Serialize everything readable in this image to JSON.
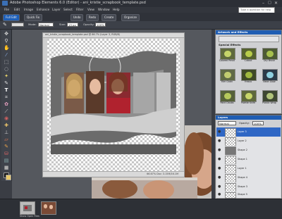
{
  "titlebar": {
    "title": "Adobe Photoshop Elements 6.0 (Editor) - ani_kristie_scrapbook_template.psd"
  },
  "menu": [
    "File",
    "Edit",
    "Image",
    "Enhance",
    "Layer",
    "Select",
    "Filter",
    "View",
    "Window",
    "Help"
  ],
  "help_search": {
    "placeholder": "Type a question for help"
  },
  "shortcuts": {
    "full_edit": "Full Edit",
    "quick_fix": "Quick Fix",
    "undo": "Undo",
    "redo": "Redo",
    "create": "Create",
    "organize": "Organize"
  },
  "options": {
    "mode": "Mode:",
    "mode_value": "Normal",
    "size": "Size:",
    "size_value": "13 px",
    "opacity": "Opacity:",
    "opacity_value": "100%"
  },
  "document": {
    "title": "ani_kristie_scrapbook_template.psd @ 66.7% (Layer 3, RGB/8)",
    "status": "66.67%   Doc: 3.15M/16.1M"
  },
  "panel_fx": {
    "title": "Artwork and Effects",
    "section": "Special Effects",
    "effects": [
      "Colored Pencil",
      "Cutout",
      "Dry Brush",
      "Film Grain",
      "Fresco",
      "Neon Glow",
      "Paint Daubs",
      "Palette Knife",
      "Plastic Wrap"
    ]
  },
  "panel_layers": {
    "title": "Layers",
    "mode": "Normal",
    "opacity_label": "Opacity:",
    "opacity_value": "100%",
    "layers": [
      "Layer 3",
      "Layer 2",
      "Shape 2",
      "Shape 1",
      "Layer 1",
      "Shape 4",
      "Shape 3",
      "Shape 5"
    ]
  },
  "project_bin": {
    "label": "Show Open Files"
  }
}
